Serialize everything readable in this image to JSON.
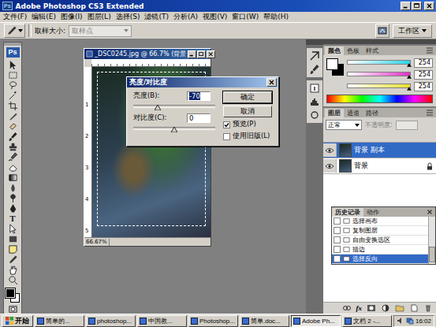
{
  "app": {
    "logo": "Ps",
    "title": "Adobe Photoshop CS3 Extended"
  },
  "menu": [
    "文件(F)",
    "编辑(E)",
    "图像(I)",
    "图层(L)",
    "选择(S)",
    "滤镜(T)",
    "分析(A)",
    "视图(V)",
    "窗口(W)",
    "帮助(H)"
  ],
  "options_bar": {
    "sample_size_label": "取样大小:",
    "sample_size_value": "取样点",
    "sample_size_disabled": true,
    "workspace_label": "工作区"
  },
  "toolbox": {
    "logo": "Ps",
    "type_tool_glyph": "T"
  },
  "document": {
    "title": "_DSC0245.jpg @ 66.7% (背景",
    "zoom": "66.67%",
    "ruler_numbers": [
      "1",
      "2",
      "3",
      "4",
      "5"
    ]
  },
  "dialog": {
    "title": "亮度/对比度",
    "fields": [
      {
        "label": "亮度(B):",
        "value": "-70",
        "value_selected": true,
        "level": 0.3
      },
      {
        "label": "对比度(C):",
        "value": "0",
        "value_selected": false,
        "level": 0.5
      }
    ],
    "buttons": [
      {
        "label": "确定",
        "default": true
      },
      {
        "label": "取消",
        "default": false
      }
    ],
    "checkboxes": [
      {
        "label": "预览(P)",
        "checked": true
      },
      {
        "label": "使用旧版(L)",
        "checked": false
      }
    ]
  },
  "color_panel": {
    "tabs": [
      {
        "label": "颜色",
        "selected": true
      },
      {
        "label": "色板",
        "selected": false
      },
      {
        "label": "样式",
        "selected": false
      }
    ],
    "channels": [
      {
        "value": "254",
        "level": 0.97,
        "color": "#2ad4e8"
      },
      {
        "value": "254",
        "level": 0.97,
        "color": "#e030c8"
      },
      {
        "value": "254",
        "level": 0.97,
        "color": "#e8e030"
      }
    ]
  },
  "layers_panel": {
    "tabs": [
      {
        "label": "图层",
        "selected": true
      },
      {
        "label": "通道",
        "selected": false
      },
      {
        "label": "路径",
        "selected": false
      }
    ],
    "blend_mode": "正常",
    "opacity_label": "不透明度:",
    "opacity_disabled": true,
    "layers": [
      {
        "name": "背景 副本",
        "selected": true,
        "visible": true,
        "locked": false
      },
      {
        "name": "背景",
        "selected": false,
        "visible": true,
        "locked": true
      }
    ],
    "fx_label": "fx"
  },
  "history_panel": {
    "tabs": [
      {
        "label": "历史记录",
        "selected": true
      },
      {
        "label": "动作",
        "selected": false
      }
    ],
    "items": [
      {
        "label": "选择画布",
        "selected": false
      },
      {
        "label": "复制图层",
        "selected": false
      },
      {
        "label": "自由变换选区",
        "selected": false
      },
      {
        "label": "描边",
        "selected": false
      },
      {
        "label": "选择反向",
        "selected": true
      }
    ]
  },
  "taskbar": {
    "start": "开始",
    "tasks": [
      {
        "label": "简单的...",
        "active": false
      },
      {
        "label": "photoshop...",
        "active": false
      },
      {
        "label": "中国教...",
        "active": false
      },
      {
        "label": "Photoshop...",
        "active": false
      },
      {
        "label": "简单.doc...",
        "active": false
      },
      {
        "label": "Adobe Ph...",
        "active": true
      },
      {
        "label": "文档 2 -...",
        "active": false
      }
    ],
    "clock": "16:02"
  }
}
